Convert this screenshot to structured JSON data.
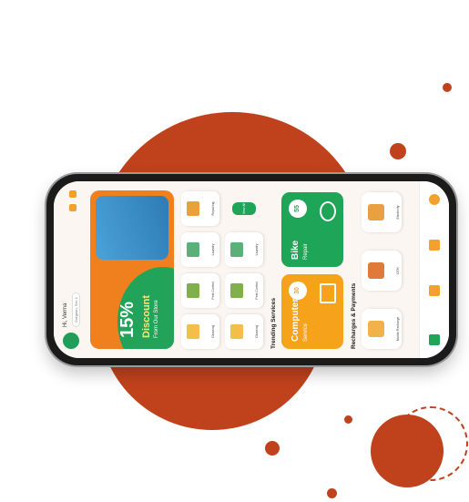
{
  "header": {
    "greeting": "Hi, Verma",
    "location": "Gurgaon, Sec 1"
  },
  "banner": {
    "percent": "15%",
    "word": "Discount",
    "subtitle": "From Our Store"
  },
  "services": [
    {
      "label": "Cleaning"
    },
    {
      "label": "Pest Control"
    },
    {
      "label": "Laundry"
    },
    {
      "label": "Repairing"
    },
    {
      "label": "Cleaning"
    },
    {
      "label": "Pest Control"
    },
    {
      "label": "Laundry"
    }
  ],
  "view_all_label": "View All",
  "trending": {
    "title": "Trending Services",
    "cards": [
      {
        "title_line1": "Computer",
        "title_line2": "Service",
        "badge": "30",
        "color": "#f7a21b"
      },
      {
        "title_line1": "Bike",
        "title_line2": "Repair",
        "badge": "55",
        "color": "#1ea557"
      }
    ]
  },
  "recharges": {
    "title": "Recharges & Payments",
    "items": [
      {
        "label": "Mobile Recharge"
      },
      {
        "label": "DTH"
      },
      {
        "label": "Electricity"
      }
    ]
  },
  "colors": {
    "accent_orange": "#f07f1e",
    "accent_green": "#1ea557",
    "deco_red": "#c0421d"
  }
}
